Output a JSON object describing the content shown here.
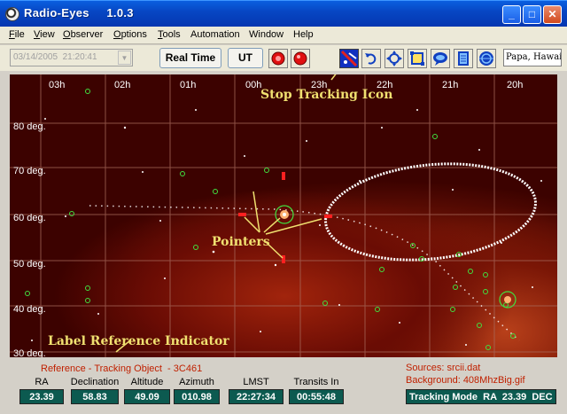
{
  "window": {
    "title": "Radio-Eyes",
    "version": "1.0.3",
    "minimize": "_",
    "maximize": "□",
    "close": "✕"
  },
  "menu": [
    {
      "label": "File",
      "key": "F",
      "rest": "ile"
    },
    {
      "label": "View",
      "key": "V",
      "rest": "iew"
    },
    {
      "label": "Observer",
      "key": "O",
      "rest": "bserver"
    },
    {
      "label": "Options",
      "key": "O",
      "rest": "ptions"
    },
    {
      "label": "Tools",
      "key": "T",
      "rest": "ools"
    },
    {
      "label": "Automation",
      "key": "",
      "rest": "Automation"
    },
    {
      "label": "Window",
      "key": "",
      "rest": "Window"
    },
    {
      "label": "Help",
      "key": "",
      "rest": "Help"
    }
  ],
  "toolbar": {
    "datetime": "03/14/2005  21:20:41",
    "realtime_label": "Real Time",
    "ut_label": "UT",
    "location": "Papa, Hawaii"
  },
  "skymap": {
    "ra_labels": [
      "03h",
      "02h",
      "01h",
      "00h",
      "23h",
      "22h",
      "21h",
      "20h"
    ],
    "dec_labels": [
      "80 deg.",
      "70 deg.",
      "60 deg.",
      "50 deg.",
      "40 deg.",
      "30 deg."
    ],
    "annotations": {
      "stop_tracking": "Stop Tracking Icon",
      "pointers": "Pointers",
      "label_reference": "Label Reference Indicator"
    },
    "colors": {
      "grid": "#b06a5a",
      "annotation": "#f0e070",
      "source_ring": "#40e040",
      "pointer": "#ff2020"
    }
  },
  "status": {
    "reference": "Reference - Tracking Object  - 3C461",
    "fields": [
      {
        "label": "RA",
        "value": "23.39"
      },
      {
        "label": "Declination",
        "value": "58.83"
      },
      {
        "label": "Altitude",
        "value": "49.09"
      },
      {
        "label": "Azimuth",
        "value": "010.98"
      },
      {
        "label": "LMST",
        "value": "22:27:34"
      },
      {
        "label": "Transits In",
        "value": "00:55:48"
      }
    ],
    "sources": "Sources: srcii.dat",
    "background": "Background: 408MhzBig.gif",
    "tracking_mode": "Tracking Mode  RA  23.39  DEC"
  }
}
